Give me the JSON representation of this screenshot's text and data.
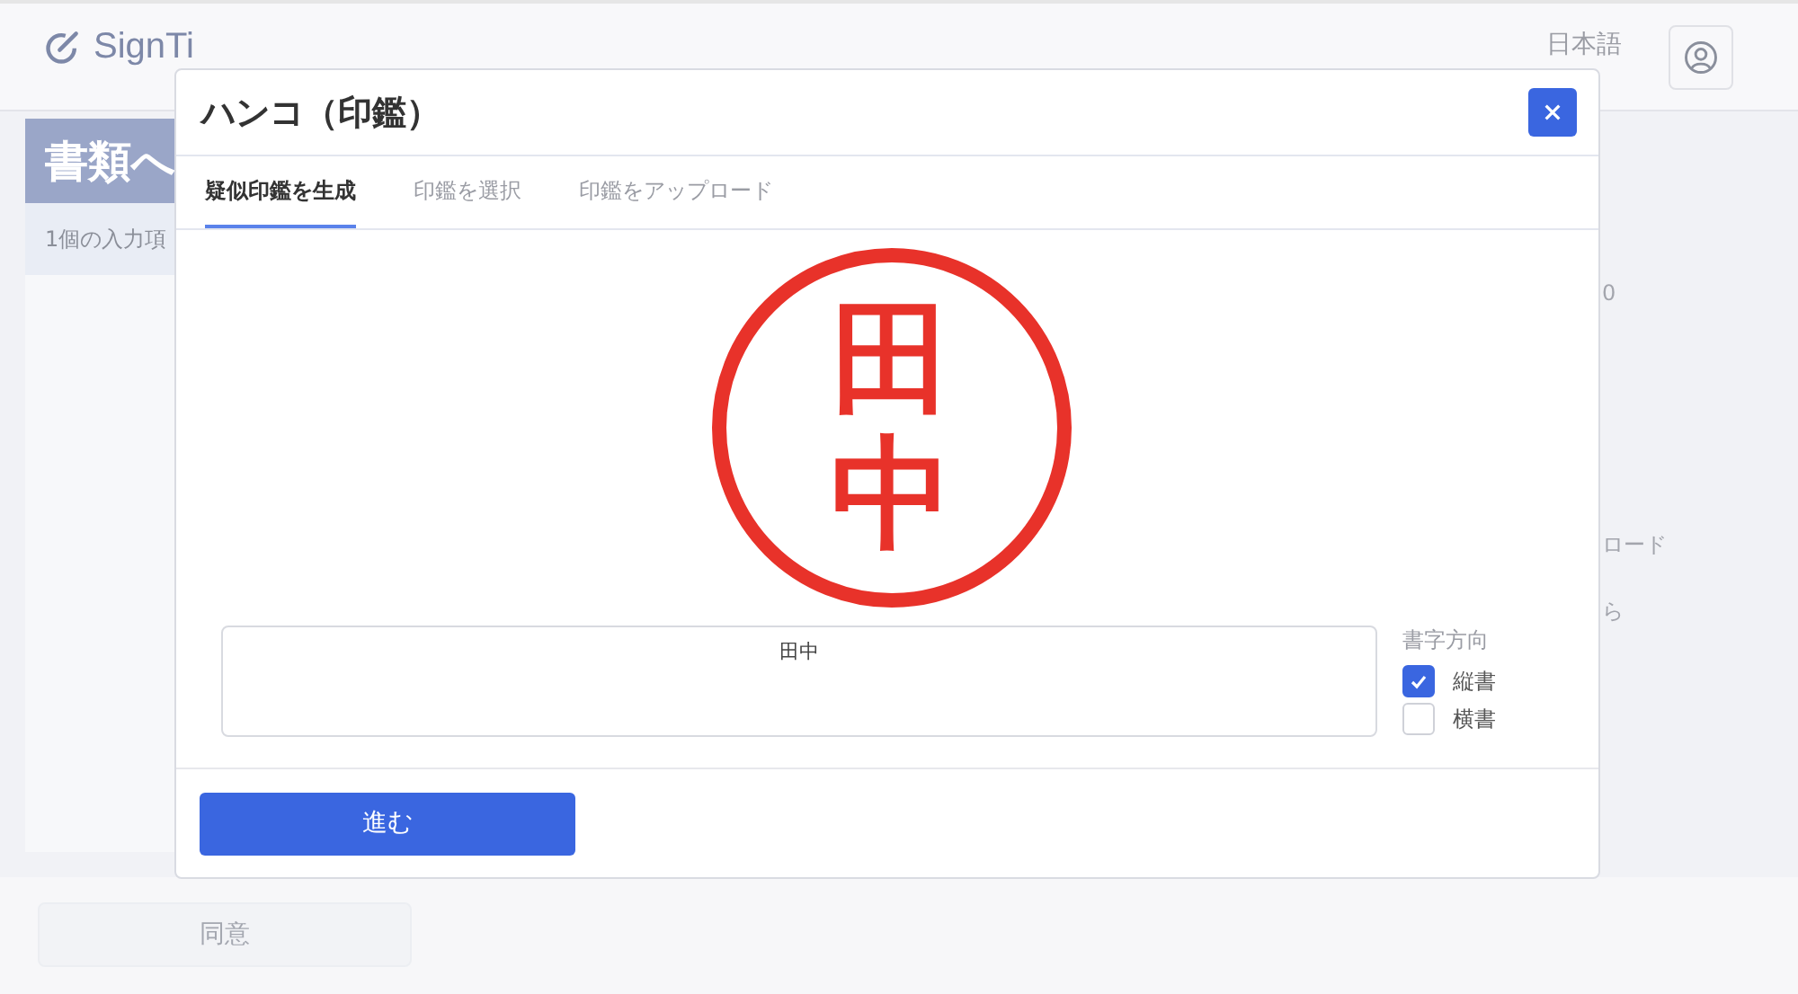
{
  "header": {
    "logo": "SignTi",
    "language": "日本語"
  },
  "background": {
    "card_title": "書類へ",
    "card_subtitle": "1個の入力項",
    "side_texts": [
      "0",
      "ロード",
      "ら"
    ],
    "agree_button": {
      "label": "同意",
      "disabled": true
    }
  },
  "dialog": {
    "title": "ハンコ（印鑑）",
    "tabs": [
      {
        "label": "疑似印鑑を生成",
        "selected": true
      },
      {
        "label": "印鑑を選択",
        "selected": false
      },
      {
        "label": "印鑑をアップロード",
        "selected": false
      }
    ],
    "seal": {
      "text": "田中"
    },
    "name_field": {
      "value": "田中"
    },
    "direction": {
      "label": "書字方向",
      "options": [
        {
          "label": "縦書",
          "checked": true
        },
        {
          "label": "横書",
          "checked": false
        }
      ]
    },
    "proceed_button": "進む"
  }
}
